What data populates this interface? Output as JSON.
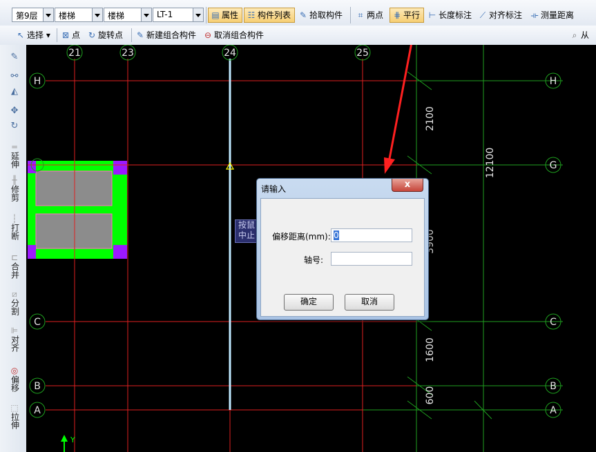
{
  "toolbar1": {
    "floor_select": "第9层",
    "category_select": "楼梯",
    "type_select": "楼梯",
    "component_select": "LT-1",
    "properties_label": "属性",
    "component_list_label": "构件列表",
    "pick_component_label": "拾取构件",
    "two_points_label": "两点",
    "parallel_label": "平行",
    "length_dim_label": "长度标注",
    "align_dim_label": "对齐标注",
    "measure_label": "测量距离"
  },
  "toolbar2": {
    "select_label": "选择",
    "point_label": "点",
    "rotate_point_label": "旋转点",
    "new_group_label": "新建组合构件",
    "cancel_group_label": "取消组合构件",
    "right_fragment": "从"
  },
  "left_toolbar": {
    "items": [
      "延伸",
      "修剪",
      "打断",
      "合并",
      "分割",
      "对齐",
      "偏移",
      "拉伸"
    ]
  },
  "canvas": {
    "axis_top": [
      "21",
      "23",
      "24",
      "25"
    ],
    "axis_side": [
      "H",
      "G",
      "C",
      "B",
      "A"
    ],
    "dimensions": [
      "2100",
      "12100",
      "1600",
      "600"
    ],
    "partial_dimension": "3900",
    "axis_y_label": "Y"
  },
  "tooltip": {
    "line1": "按鼠",
    "line2": "中止"
  },
  "dialog": {
    "title": "请输入",
    "close_label": "x",
    "offset_label": "偏移距离(mm):",
    "offset_value": "0",
    "axis_label": "轴号:",
    "axis_value": "",
    "ok_label": "确定",
    "cancel_label": "取消"
  },
  "colors": {
    "canvas_bg": "#000000",
    "axis_red": "#e02020",
    "grid_green": "#1fa01f",
    "component_green": "#00ff00",
    "component_gray": "#8c8c8c",
    "corner_purple": "#9b19ff",
    "highlight_cyan": "#bfe9ff"
  }
}
